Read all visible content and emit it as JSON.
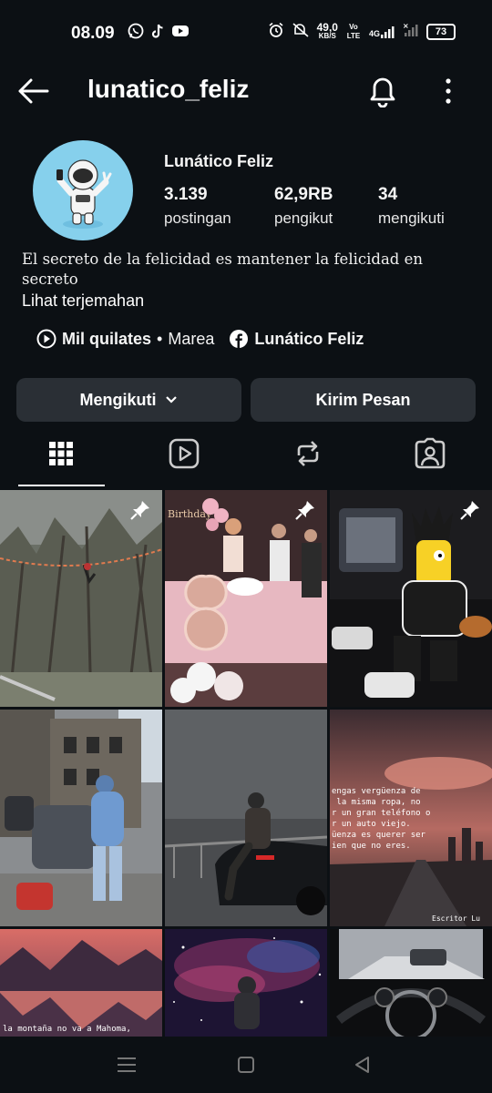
{
  "status_bar": {
    "time": "08.09",
    "left_icons": [
      "whatsapp-icon",
      "tiktok-icon",
      "youtube-icon"
    ],
    "right_icons": [
      "alarm-icon",
      "mute-icon",
      "volte-icon",
      "signal-4g-icon",
      "signal-icon"
    ],
    "net_speed_value": "49,0",
    "net_speed_unit": "KB/S",
    "volte_label": "Vo LTE",
    "net_type": "4G",
    "battery": "73"
  },
  "top_bar": {
    "username": "lunatico_feliz",
    "back_icon": "arrow-left-icon",
    "bell_icon": "bell-icon",
    "more_icon": "kebab-icon"
  },
  "profile": {
    "display_name": "Lunático Feliz",
    "stats": [
      {
        "value": "3.139",
        "label": "postingan"
      },
      {
        "value": "62,9RB",
        "label": "pengikut"
      },
      {
        "value": "34",
        "label": "mengikuti"
      }
    ],
    "bio": "El secreto de la felicidad es mantener la felicidad en secreto",
    "translate_link": "Lihat terjemahan",
    "music": {
      "title": "Mil quilates",
      "separator": "•",
      "artist": "Marea"
    },
    "facebook_link": "Lunático Feliz"
  },
  "actions": {
    "follow_label": "Mengikuti",
    "message_label": "Kirim Pesan"
  },
  "tabs": [
    "grid-icon",
    "reels-icon",
    "tagged-repost-icon",
    "tagged-person-icon"
  ],
  "posts": [
    {
      "name": "post-forest-slackline",
      "pinned": true
    },
    {
      "name": "post-birthday-party",
      "pinned": true
    },
    {
      "name": "post-cartoon-car",
      "pinned": true
    },
    {
      "name": "post-man-with-car",
      "pinned": false
    },
    {
      "name": "post-man-on-car-fog",
      "pinned": false
    },
    {
      "name": "post-quote-city",
      "pinned": false,
      "caption": "engas vergüenza de\n la misma ropa, no\nr un gran teléfono o\nr un auto viejo.\nüenza es querer ser\nien que no eres.",
      "signature": "Escritor Lu"
    },
    {
      "name": "post-mountain-lake",
      "pinned": false,
      "caption": "la montaña no va a Mahoma,"
    },
    {
      "name": "post-astronaut-galaxy",
      "pinned": false
    },
    {
      "name": "post-car-dashboard",
      "pinned": false
    }
  ],
  "nav_bar": [
    "menu-icon",
    "home-square-icon",
    "back-triangle-icon"
  ],
  "colors": {
    "background": "#0c1014",
    "button": "#2a2f35",
    "avatar_bg": "#86d0ec"
  }
}
